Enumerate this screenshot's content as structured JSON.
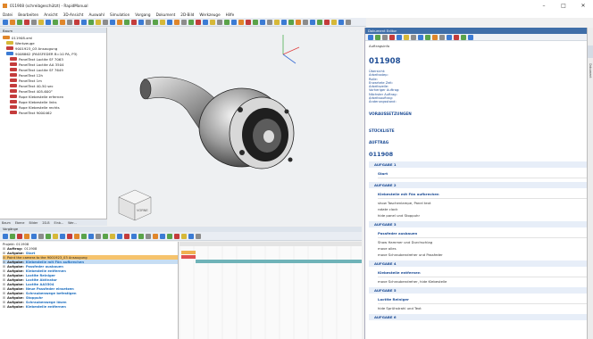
{
  "window": {
    "title": "011908 (schreibgeschützt) - RapidManual",
    "controls": [
      "–",
      "□",
      "✕"
    ]
  },
  "menu": [
    "Datei",
    "Bearbeiten",
    "Ansicht",
    "3D-Ansicht",
    "Auswahl",
    "Simulation",
    "Vorgang",
    "Dokument",
    "2D-Bild",
    "Werkzeuge",
    "Hilfe"
  ],
  "toolbar": {
    "colors": [
      "#3b7bd4",
      "#e0862a",
      "#5aa34a",
      "#c43c3c",
      "#8c8c8c",
      "#d6b838",
      "#3b7bd4",
      "#5aa34a",
      "#e0862a",
      "#8c8c8c",
      "#c43c3c",
      "#3b7bd4",
      "#5aa34a",
      "#d6b838",
      "#8c8c8c",
      "#3b7bd4",
      "#e0862a",
      "#5aa34a",
      "#c43c3c",
      "#3b7bd4",
      "#8c8c8c",
      "#5aa34a",
      "#d6b838",
      "#3b7bd4",
      "#e0862a",
      "#8c8c8c",
      "#5aa34a",
      "#c43c3c",
      "#3b7bd4",
      "#d6b838",
      "#8c8c8c",
      "#5aa34a",
      "#3b7bd4",
      "#e0862a",
      "#c43c3c",
      "#5aa34a",
      "#3b7bd4",
      "#8c8c8c",
      "#d6b838",
      "#3b7bd4",
      "#5aa34a",
      "#e0862a",
      "#8c8c8c",
      "#3b7bd4",
      "#5aa34a",
      "#c43c3c",
      "#d6b838",
      "#3b7bd4",
      "#8c8c8c"
    ]
  },
  "tree": {
    "header": "Baum",
    "items": [
      {
        "label": "011908.xml",
        "color": "#e0862a"
      },
      {
        "label": "Werkzeuge",
        "color": "#d6b838"
      },
      {
        "label": "9001923_03 Ansaugung",
        "color": "#c43c3c"
      },
      {
        "label": "9008862 (PASSFEDER B=10 PA, P3)",
        "color": "#3b7bd4"
      },
      {
        "label": "PanelText Loctite SF 7063",
        "color": "#c43c3c"
      },
      {
        "label": "PanelText Loctite AA 3504",
        "color": "#c43c3c"
      },
      {
        "label": "PanelText Loctite SF 7649",
        "color": "#c43c3c"
      },
      {
        "label": "PanelText 12h",
        "color": "#c43c3c"
      },
      {
        "label": "PanelText 1m",
        "color": "#c43c3c"
      },
      {
        "label": "PanelText 40-50 sec",
        "color": "#c43c3c"
      },
      {
        "label": "PanelText 405-600°",
        "color": "#c43c3c"
      },
      {
        "label": "Rope Klebestelle erfernen",
        "color": "#c43c3c"
      },
      {
        "label": "Rope Klebestelle links",
        "color": "#c43c3c"
      },
      {
        "label": "Rope Klebestelle rechts",
        "color": "#c43c3c"
      },
      {
        "label": "PanelText 9000462",
        "color": "#c43c3c"
      }
    ],
    "tabs": [
      "Baum",
      "Ebene",
      "Bilder",
      "2D-B",
      "Einb...",
      "Wer..."
    ]
  },
  "viewport": {
    "cube_label": "VORNE"
  },
  "gantt": {
    "title": "Vorgänge",
    "header_left": "Projekt: 011908",
    "rows": [
      {
        "kw": "Auftrag:",
        "text": "011908",
        "style": ""
      },
      {
        "kw": "Aufgabe:",
        "text": "Start",
        "style": ""
      },
      {
        "kw": "",
        "text": "Point the camera to the 9001923_03 Ansaugung",
        "style": "hl"
      },
      {
        "kw": "Aufgabe:",
        "text": "Klebestelle mit Fön aufbrechen",
        "style": "sel"
      },
      {
        "kw": "Aufgabe:",
        "text": "Passfeder ausbauen",
        "style": ""
      },
      {
        "kw": "Aufgabe:",
        "text": "Klebestelle entfernen",
        "style": ""
      },
      {
        "kw": "Aufgabe:",
        "text": "Loctite Reiniger",
        "style": ""
      },
      {
        "kw": "Aufgabe:",
        "text": "Loctite Aktivator",
        "style": ""
      },
      {
        "kw": "Aufgabe:",
        "text": "Loctite AA3504",
        "style": ""
      },
      {
        "kw": "Aufgabe:",
        "text": "Neue Passfeder einsetzen",
        "style": ""
      },
      {
        "kw": "Aufgabe:",
        "text": "Schraubenwege befestigen",
        "style": ""
      },
      {
        "kw": "Aufgabe:",
        "text": "Stoppuhr",
        "style": ""
      },
      {
        "kw": "Aufgabe:",
        "text": "Schraubenwege lösen",
        "style": ""
      },
      {
        "kw": "Aufgabe:",
        "text": "Klebestelle entfernen",
        "style": ""
      }
    ],
    "toolbar_colors": [
      "#3b7bd4",
      "#5aa34a",
      "#c43c3c",
      "#e0862a",
      "#3b7bd4",
      "#8c8c8c",
      "#5aa34a",
      "#d6b838",
      "#3b7bd4",
      "#c43c3c",
      "#e0862a",
      "#5aa34a",
      "#3b7bd4",
      "#8c8c8c",
      "#5aa34a",
      "#d6b838",
      "#3b7bd4",
      "#c43c3c",
      "#3b7bd4",
      "#5aa34a",
      "#8c8c8c",
      "#e0862a",
      "#3b7bd4",
      "#5aa34a",
      "#c43c3c",
      "#d6b838",
      "#3b7bd4",
      "#8c8c8c"
    ]
  },
  "instructions": {
    "panel_title": "Dokument Editor",
    "auftragsinfo": "Auftragsinfo",
    "order_id": "011908",
    "meta": [
      "Übersicht:",
      "Arbeitsstep:",
      "Rolle:",
      "Erwartete Zeit:",
      "Arbeitszeile:",
      "Vorheriger Auftrag:",
      "Nächster Auftrag:",
      "Arbeitsauftrag:",
      "Änderungsstand:"
    ],
    "voraussetzungen": "VORAUSSETZUNGEN",
    "stueckliste": "STÜCKLISTE",
    "auftrag": "AUFTRAG",
    "order_id_2": "011908",
    "aufgabe1": "AUFGABE 1",
    "start": "Start",
    "aufgabe2": "AUFGABE 2",
    "step2_title": "Klebestelle mit Fön aufbrechen",
    "step2_lines": [
      "show Taschenlampe, Panel text",
      "rotate clock",
      "hide panel und Stoppuhr"
    ],
    "aufgabe3": "AUFGABE 3",
    "step3_title": "Passfeder ausbauen",
    "step3_lines": [
      "Show Hammer und Durchschlag",
      "move alles",
      "move Schraubendreher und Passfeder"
    ],
    "aufgabe4": "AUFGABE 4",
    "step4_title": "Klebestelle entfernen",
    "step4_lines": [
      "move Schraubendreher, hide Klebestelle"
    ],
    "aufgabe5": "AUFGABE 5",
    "step5_title": "Loctite Reiniger",
    "step5_lines": [
      "hide Sprühstrahl und Text"
    ],
    "aufgabe6": "AUFGABE 6",
    "side_tab": "Dokument"
  }
}
